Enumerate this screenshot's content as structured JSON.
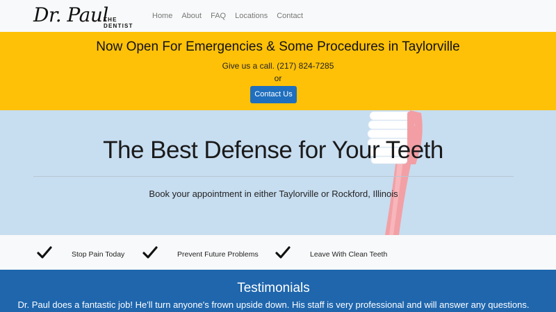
{
  "brand": {
    "name": "Dr. Paul",
    "tagline": "THE DENTIST"
  },
  "nav": [
    {
      "label": "Home"
    },
    {
      "label": "About"
    },
    {
      "label": "FAQ"
    },
    {
      "label": "Locations"
    },
    {
      "label": "Contact"
    }
  ],
  "alert": {
    "heading": "Now Open For Emergencies & Some Procedures in Taylorville",
    "call_text": "Give us a call. (217) 824-7285",
    "or_text": "or",
    "button_label": "Contact Us"
  },
  "hero": {
    "title": "The Best Defense for Your Teeth",
    "subtitle": "Book your appointment in either Taylorville or Rockford, Illinois"
  },
  "features": [
    {
      "label": "Stop Pain Today",
      "icon": "check-icon"
    },
    {
      "label": "Prevent Future Problems",
      "icon": "check-icon"
    },
    {
      "label": "Leave With Clean Teeth",
      "icon": "check-icon"
    }
  ],
  "testimonials": {
    "heading": "Testimonials",
    "quote": "Dr. Paul does a fantastic job! He'll turn anyone's frown upside down. His staff is very professional and will answer any questions."
  },
  "colors": {
    "alert_bg": "#ffc107",
    "hero_bg": "#c7ddf0",
    "button_bg": "#1f6fbe",
    "testimonials_bg": "#1f66ad"
  }
}
